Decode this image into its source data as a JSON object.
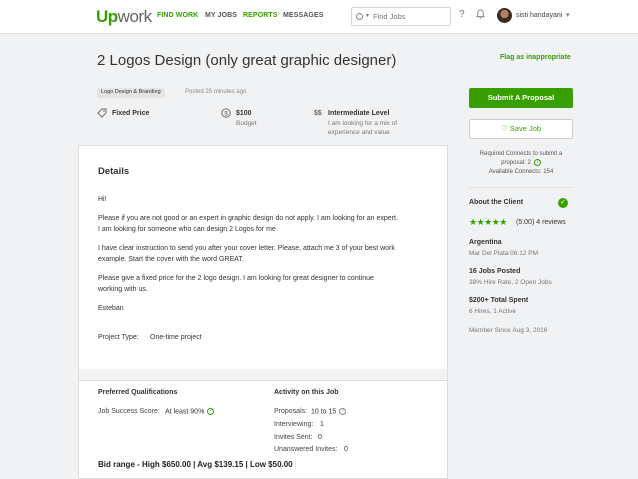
{
  "header": {
    "logo_up": "Up",
    "logo_work": "work",
    "nav": [
      {
        "label": "FIND WORK",
        "active": true
      },
      {
        "label": "MY JOBS",
        "active": false
      },
      {
        "label": "REPORTS",
        "active": true
      },
      {
        "label": "MESSAGES",
        "active": false
      }
    ],
    "search_placeholder": "Find Jobs",
    "help_icon": "?",
    "username": "sisti handayani"
  },
  "job": {
    "title": "2 Logos Design (only great graphic designer)",
    "flag_label": "Flag as inappropriate",
    "category": "Logo Design & Branding",
    "posted": "Posted 25 minutes ago",
    "price_type": "Fixed Price",
    "budget_value": "$100",
    "budget_label": "Budget",
    "level_symbol": "$$",
    "level": "Intermediate Level",
    "level_desc_1": "I am looking for a mix of",
    "level_desc_2": "experience and value"
  },
  "details": {
    "heading": "Details",
    "lines": {
      "l1": "Hi!",
      "l2": "Please if you are not good or an expert in graphic design do not apply. I am looking for an expert.",
      "l3": "I am looking for someone who can design 2 Logos for me.",
      "l4": "I have clear instruction to send you after your cover letter. Please, attach me 3 of your best work",
      "l5": "example. Start the cover with the word GREAT.",
      "l6": "Please give a fixed price for the 2 logo design. I am looking for great designer to continue",
      "l7": "working with us.",
      "l8": "Esteban"
    },
    "project_type_label": "Project Type:",
    "project_type_value": "One-time project"
  },
  "qualifications": {
    "heading": "Preferred Qualifications",
    "jss_label": "Job Success Score:",
    "jss_value": "At least 90%"
  },
  "activity": {
    "heading": "Activity on this Job",
    "proposals_label": "Proposals:",
    "proposals_value": "10 to 15",
    "interviewing_label": "Interviewing:",
    "interviewing_value": "1",
    "invites_label": "Invites Sent:",
    "invites_value": "0",
    "unanswered_label": "Unanswered Invites:",
    "unanswered_value": "0"
  },
  "bid_range": "Bid range - High $650.00 | Avg $139.15 | Low $50.00",
  "sidebar": {
    "submit_label": "Submit A Proposal",
    "save_label": "Save Job",
    "connects_line1": "Required Connects to submit a",
    "connects_line2": "proposal: 2",
    "connects_line3": "Available Connects: 154",
    "about_client": "About the Client",
    "rating_text": "(5.00) 4 reviews",
    "rating_value": 5,
    "country": "Argentina",
    "city_time": "Mar Del Plata 06:12 PM",
    "jobs_posted": "16 Jobs Posted",
    "hire_rate": "38% Hire Rate, 2 Open Jobs",
    "total_spent": "$200+ Total Spent",
    "hires": "6 Hires, 1 Active",
    "member_since": "Member Since Aug 3, 2016"
  },
  "colors": {
    "brand": "#37a000",
    "background": "#f1f2f4"
  }
}
